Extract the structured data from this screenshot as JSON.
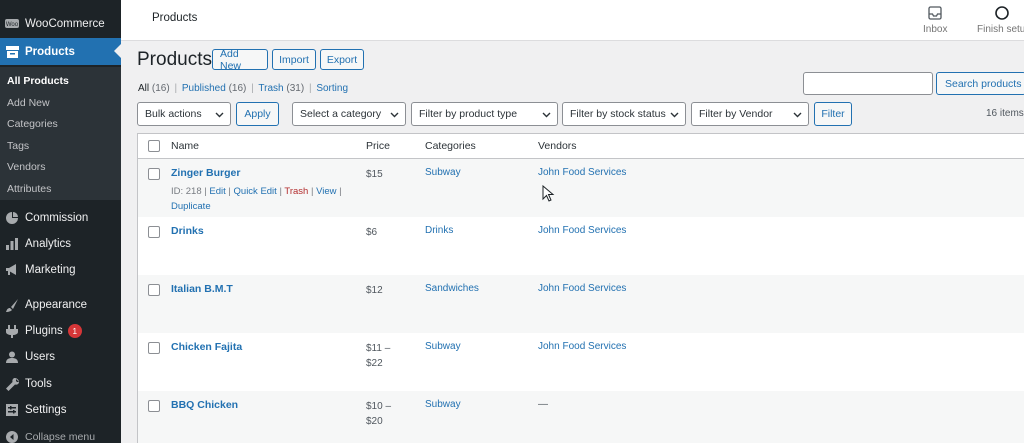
{
  "sidebar": {
    "brand": "WooCommerce",
    "products": "Products",
    "submenu": [
      "All Products",
      "Add New",
      "Categories",
      "Tags",
      "Vendors",
      "Attributes"
    ],
    "commission": "Commission",
    "analytics": "Analytics",
    "marketing": "Marketing",
    "appearance": "Appearance",
    "plugins": "Plugins",
    "plugins_badge": "1",
    "users": "Users",
    "tools": "Tools",
    "settings": "Settings",
    "collapse": "Collapse menu"
  },
  "topbar": {
    "title": "Products",
    "inbox": "Inbox",
    "finish_setup": "Finish setu"
  },
  "header": {
    "title": "Products",
    "add_new": "Add New",
    "import": "Import",
    "export": "Export"
  },
  "views": {
    "all": "All",
    "all_count": "(16)",
    "published": "Published",
    "published_count": "(16)",
    "trash": "Trash",
    "trash_count": "(31)",
    "sorting": "Sorting",
    "sep": "|"
  },
  "search": {
    "value": "",
    "button": "Search products"
  },
  "filters": {
    "bulk_actions": "Bulk actions",
    "apply": "Apply",
    "category": "Select a category",
    "product_type": "Filter by product type",
    "stock_status": "Filter by stock status",
    "vendor": "Filter by Vendor",
    "filter": "Filter",
    "items_count": "16 items"
  },
  "table": {
    "columns": {
      "name": "Name",
      "price": "Price",
      "categories": "Categories",
      "vendors": "Vendors"
    },
    "rows": [
      {
        "name": "Zinger Burger",
        "price_line1": "$15",
        "price_line2": "",
        "category": "Subway",
        "vendor": "John Food Services",
        "actions": {
          "id": "ID: 218",
          "edit": "Edit",
          "quick_edit": "Quick Edit",
          "trash": "Trash",
          "view": "View",
          "duplicate": "Duplicate",
          "sep": "|"
        }
      },
      {
        "name": "Drinks",
        "price_line1": "$6",
        "price_line2": "",
        "category": "Drinks",
        "vendor": "John Food Services"
      },
      {
        "name": "Italian B.M.T",
        "price_line1": "$12",
        "price_line2": "",
        "category": "Sandwiches",
        "vendor": "John Food Services"
      },
      {
        "name": "Chicken Fajita",
        "price_line1": "$11 –",
        "price_line2": "$22",
        "category": "Subway",
        "vendor": "John Food Services"
      },
      {
        "name": "BBQ Chicken",
        "price_line1": "$10 –",
        "price_line2": "$20",
        "category": "Subway",
        "vendor": "—"
      }
    ]
  }
}
